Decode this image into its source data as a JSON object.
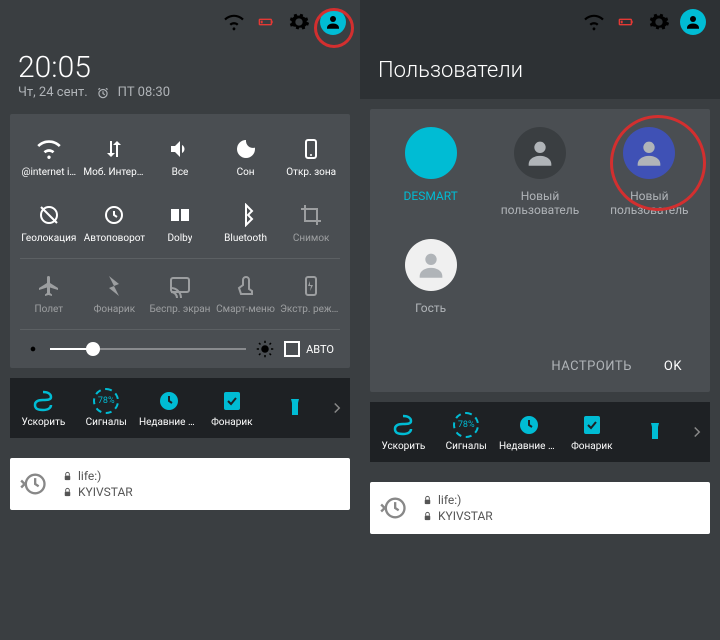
{
  "left": {
    "clock": "20:05",
    "date": "Чт, 24 сент.",
    "alarm": "ПТ 08:30",
    "tiles": [
      {
        "id": "wifi",
        "label": "@internet i…"
      },
      {
        "id": "mobiledata",
        "label": "Моб. Интернет"
      },
      {
        "id": "volume",
        "label": "Все"
      },
      {
        "id": "dnd",
        "label": "Сон"
      },
      {
        "id": "hotspot",
        "label": "Откр. зона"
      },
      {
        "id": "location",
        "label": "Геолокация"
      },
      {
        "id": "autorotate",
        "label": "Автоповорот"
      },
      {
        "id": "dolby",
        "label": "Dolby"
      },
      {
        "id": "bluetooth",
        "label": "Bluetooth"
      },
      {
        "id": "screenshot",
        "label": "Снимок",
        "dim": true
      },
      {
        "id": "airplane",
        "label": "Полет",
        "dim": true
      },
      {
        "id": "flashlight",
        "label": "Фонарик",
        "dim": true
      },
      {
        "id": "cast",
        "label": "Беспр. экран",
        "dim": true
      },
      {
        "id": "smartmenu",
        "label": "Смарт-меню",
        "dim": true
      },
      {
        "id": "powersave",
        "label": "Экстр. режим",
        "dim": true
      }
    ],
    "brightness": {
      "auto_label": "АВТО"
    },
    "strip": [
      {
        "id": "booster",
        "label": "Ускорить"
      },
      {
        "id": "signals",
        "label": "Сигналы",
        "badge": "78%"
      },
      {
        "id": "recent",
        "label": "Недавние п…"
      },
      {
        "id": "flash",
        "label": "Фонарик"
      },
      {
        "id": "torch",
        "label": " "
      }
    ],
    "notif": {
      "line1": "life:)",
      "line2": "KYIVSTAR"
    }
  },
  "right": {
    "title": "Пользователи",
    "users": [
      {
        "id": "owner",
        "label": "DESMART",
        "active": true,
        "tone": "teal"
      },
      {
        "id": "new1",
        "label": "Новый\nпользователь",
        "tone": "dark"
      },
      {
        "id": "new2",
        "label": "Новый\nпользователь",
        "tone": "indigo"
      },
      {
        "id": "guest",
        "label": "Гость",
        "tone": "white"
      }
    ],
    "actions": {
      "configure": "НАСТРОИТЬ",
      "ok": "OK"
    },
    "strip": [
      {
        "id": "booster",
        "label": "Ускорить"
      },
      {
        "id": "signals",
        "label": "Сигналы",
        "badge": "78%"
      },
      {
        "id": "recent",
        "label": "Недавние п…"
      },
      {
        "id": "flash",
        "label": "Фонарик"
      },
      {
        "id": "torch",
        "label": " "
      }
    ],
    "notif": {
      "line1": "life:)",
      "line2": "KYIVSTAR"
    }
  }
}
